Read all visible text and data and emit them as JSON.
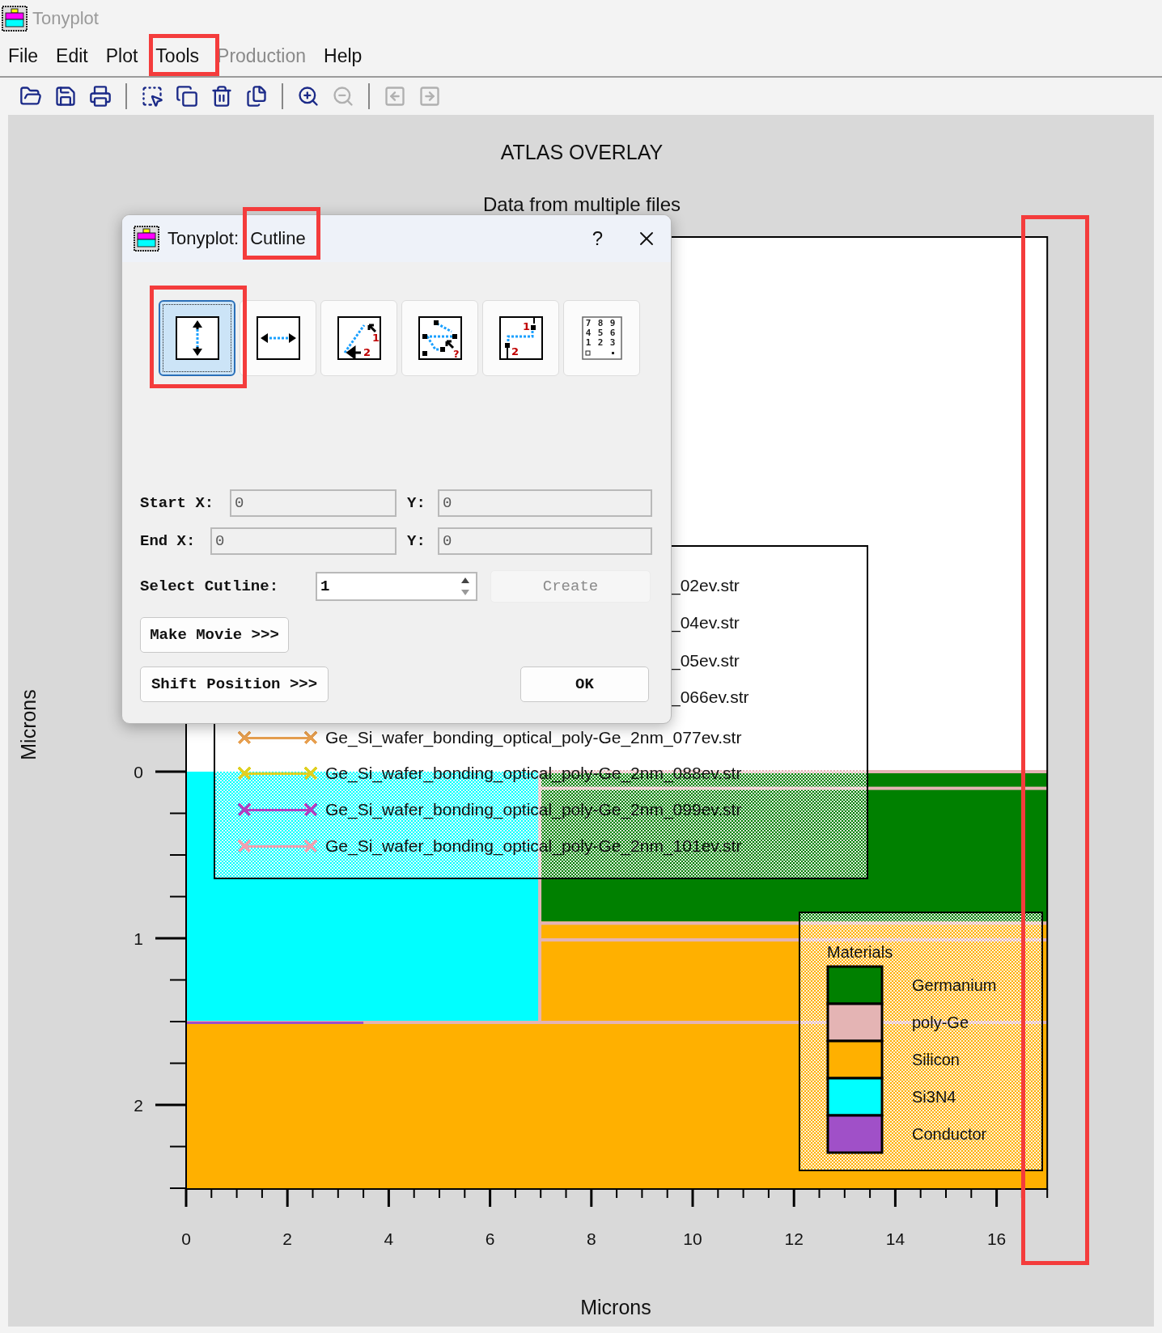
{
  "window": {
    "title": "Tonyplot"
  },
  "menu": [
    {
      "label": "File",
      "disabled": false
    },
    {
      "label": "Edit",
      "disabled": false
    },
    {
      "label": "Plot",
      "disabled": false
    },
    {
      "label": "Tools",
      "disabled": false
    },
    {
      "label": "Production",
      "disabled": true
    },
    {
      "label": "Help",
      "disabled": false
    }
  ],
  "toolbar": [
    {
      "kind": "open",
      "disabled": false
    },
    {
      "kind": "save",
      "disabled": false
    },
    {
      "kind": "print",
      "disabled": false
    },
    {
      "kind": "separator"
    },
    {
      "kind": "select",
      "disabled": false
    },
    {
      "kind": "copy",
      "disabled": false
    },
    {
      "kind": "delete",
      "disabled": false
    },
    {
      "kind": "duplicate",
      "disabled": false
    },
    {
      "kind": "separator"
    },
    {
      "kind": "zoom-in",
      "disabled": false
    },
    {
      "kind": "zoom-out",
      "disabled": true
    },
    {
      "kind": "separator"
    },
    {
      "kind": "back",
      "disabled": true
    },
    {
      "kind": "forward",
      "disabled": true
    }
  ],
  "plot": {
    "title": "ATLAS OVERLAY",
    "subtitle": "Data from multiple files",
    "x_label": "Microns",
    "y_label": "Microns",
    "x_ticks": [
      "0",
      "2",
      "4",
      "6",
      "8",
      "10",
      "12",
      "14",
      "16"
    ],
    "y_ticks": [
      "0",
      "1",
      "2"
    ],
    "files": [
      {
        "label": "_02ev.str",
        "kind": "partial"
      },
      {
        "label": "_04ev.str",
        "kind": "partial"
      },
      {
        "label": "_05ev.str",
        "kind": "partial"
      },
      {
        "label": "_066ev.str",
        "kind": "partial"
      },
      {
        "label": "Ge_Si_wafer_bonding_optical_poly-Ge_2nm_077ev.str",
        "kind": "full",
        "color": "#e8a050"
      },
      {
        "label": "Ge_Si_wafer_bonding_optical_poly-Ge_2nm_088ev.str",
        "kind": "full",
        "color": "#e0d020"
      },
      {
        "label": "Ge_Si_wafer_bonding_optical_poly-Ge_2nm_099ev.str",
        "kind": "full",
        "color": "#b040c0"
      },
      {
        "label": "Ge_Si_wafer_bonding_optical_poly-Ge_2nm_101ev.str",
        "kind": "full",
        "color": "#f0a0b0"
      }
    ],
    "materials": {
      "title": "Materials",
      "items": [
        {
          "label": "Germanium",
          "color": "#008000"
        },
        {
          "label": "poly-Ge",
          "color": "#e4b4b4"
        },
        {
          "label": "Silicon",
          "color": "#ffb000"
        },
        {
          "label": "Si3N4",
          "color": "#00ffff"
        },
        {
          "label": "Conductor",
          "color": "#a050c8"
        }
      ]
    }
  },
  "dialog": {
    "title": "Tonyplot: Cutline",
    "help": "?",
    "tools": [
      {
        "kind": "vertical",
        "selected": true
      },
      {
        "kind": "horizontal",
        "selected": false
      },
      {
        "kind": "arbitrary",
        "selected": false,
        "glyphs": [
          "1",
          "2"
        ]
      },
      {
        "kind": "polyline",
        "selected": false,
        "glyphs": [
          "?"
        ]
      },
      {
        "kind": "step",
        "selected": false,
        "glyphs": [
          "1",
          "2"
        ]
      },
      {
        "kind": "keypad",
        "selected": false,
        "glyphs": [
          "7",
          "8",
          "9",
          "4",
          "5",
          "6",
          "1",
          "2",
          "3"
        ]
      }
    ],
    "start_x": {
      "label": "Start X:",
      "value": "0",
      "disabled": true
    },
    "start_y": {
      "label": "Y:",
      "value": "0",
      "disabled": true
    },
    "end_x": {
      "label": "End X:",
      "value": "0",
      "disabled": true
    },
    "end_y": {
      "label": "Y:",
      "value": "0",
      "disabled": true
    },
    "cutline": {
      "label": "Select Cutline:",
      "value": "1"
    },
    "create": {
      "label": "Create",
      "disabled": true
    },
    "make_movie": {
      "label": "Make Movie >>>"
    },
    "shift_position": {
      "label": "Shift Position >>>"
    },
    "ok": {
      "label": "OK"
    }
  }
}
